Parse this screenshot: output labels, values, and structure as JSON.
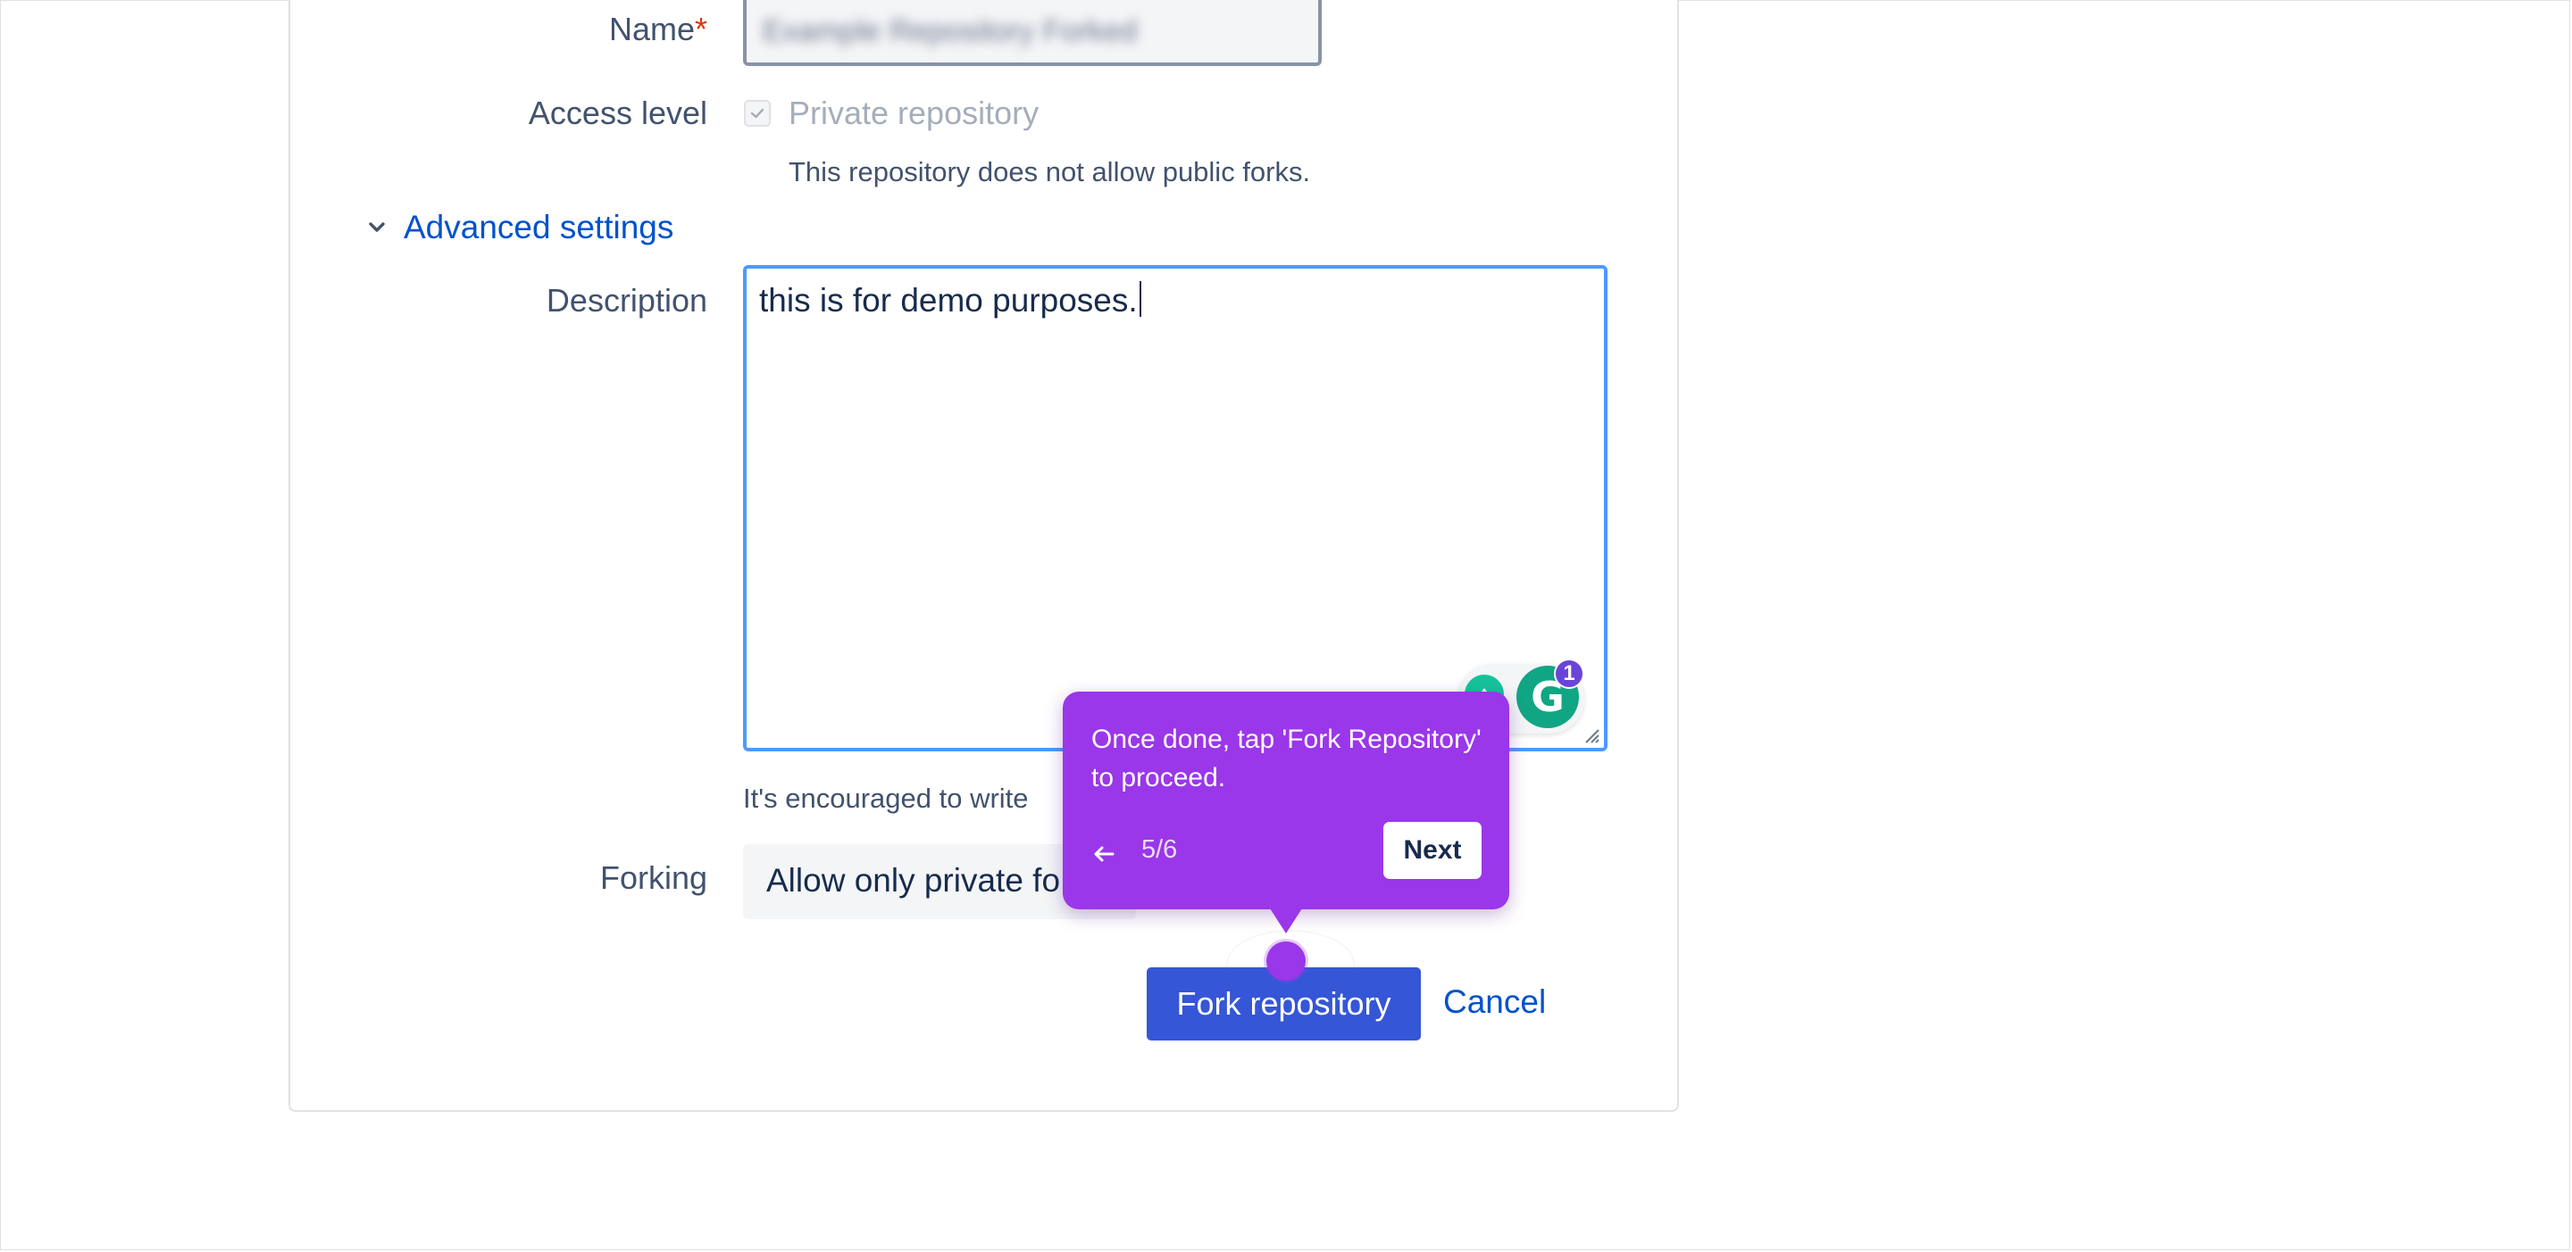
{
  "form": {
    "name_label": "Name",
    "required_mark": "*",
    "name_value": "Example Repository Forked",
    "access_label": "Access level",
    "private_label": "Private repository",
    "private_help": "This repository does not allow public forks.",
    "advanced_label": "Advanced settings",
    "description_label": "Description",
    "description_value": "this is for demo purposes.",
    "description_help": "It's encouraged to write",
    "forking_label": "Forking",
    "forking_value": "Allow only private fo",
    "submit_label": "Fork repository",
    "cancel_label": "Cancel"
  },
  "grammarly": {
    "badge_count": "1",
    "g_letter": "G"
  },
  "tour": {
    "message": "Once done, tap 'Fork Repository' to proceed.",
    "step": "5/6",
    "next_label": "Next"
  },
  "colors": {
    "accent_purple": "#9a37e9",
    "primary_button": "#3556d6",
    "link_blue": "#0052cc",
    "focus_border": "#4c9aff"
  },
  "icons": [
    "checkmark-icon",
    "chevron-down-icon",
    "resize-handle-icon",
    "grammarly-icon",
    "arrow-left-icon"
  ]
}
